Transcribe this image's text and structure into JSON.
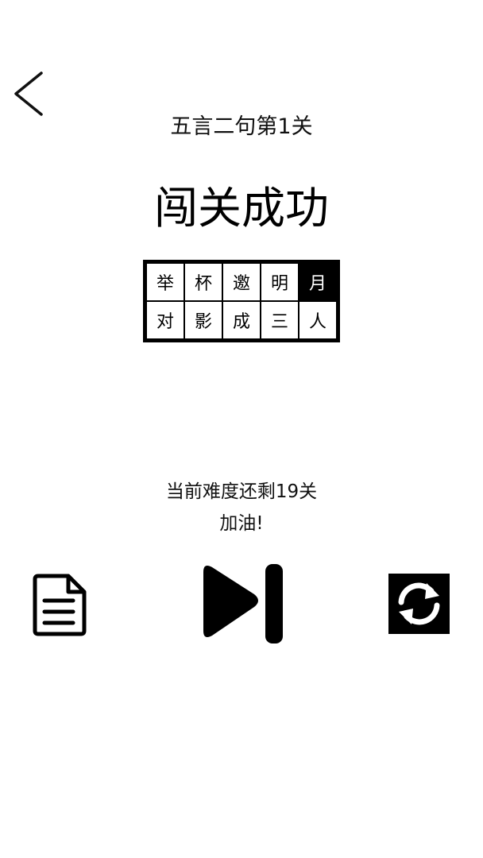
{
  "header": {
    "back_icon": "chevron-left-icon",
    "level_title": "五言二句第1关"
  },
  "result": {
    "heading": "闯关成功"
  },
  "poem_grid": {
    "rows": [
      [
        "举",
        "杯",
        "邀",
        "明",
        "月"
      ],
      [
        "对",
        "影",
        "成",
        "三",
        "人"
      ]
    ],
    "highlighted": "月"
  },
  "progress": {
    "remaining_text": "当前难度还剩19关",
    "cheer_text": "加油!"
  },
  "actions": {
    "left_icon": "document-icon",
    "center_icon": "skip-next-icon",
    "right_icon": "refresh-icon"
  },
  "colors": {
    "background": "#ffffff",
    "foreground": "#000000",
    "highlight_text": "#ffffff"
  }
}
